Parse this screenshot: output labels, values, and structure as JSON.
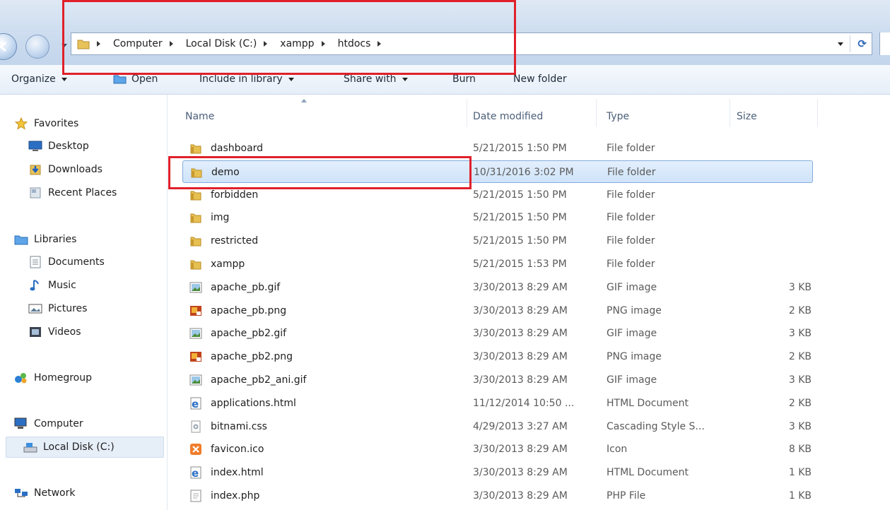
{
  "breadcrumb": [
    "Computer",
    "Local Disk (C:)",
    "xampp",
    "htdocs"
  ],
  "toolbar": {
    "organize": "Organize",
    "open": "Open",
    "include_in_library": "Include in library",
    "share_with": "Share with",
    "burn": "Burn",
    "new_folder": "New folder"
  },
  "nav": {
    "favorites": "Favorites",
    "desktop": "Desktop",
    "downloads": "Downloads",
    "recent_places": "Recent Places",
    "libraries": "Libraries",
    "documents": "Documents",
    "music": "Music",
    "pictures": "Pictures",
    "videos": "Videos",
    "homegroup": "Homegroup",
    "computer": "Computer",
    "local_disk": "Local Disk (C:)",
    "network": "Network"
  },
  "columns": {
    "name": "Name",
    "date": "Date modified",
    "type": "Type",
    "size": "Size"
  },
  "files": [
    {
      "name": "dashboard",
      "date": "5/21/2015 1:50 PM",
      "type": "File folder",
      "size": "",
      "icon": "folder-icon"
    },
    {
      "name": "demo",
      "date": "10/31/2016 3:02 PM",
      "type": "File folder",
      "size": "",
      "icon": "folder-icon",
      "selected": true
    },
    {
      "name": "forbidden",
      "date": "5/21/2015 1:50 PM",
      "type": "File folder",
      "size": "",
      "icon": "folder-icon"
    },
    {
      "name": "img",
      "date": "5/21/2015 1:50 PM",
      "type": "File folder",
      "size": "",
      "icon": "folder-icon"
    },
    {
      "name": "restricted",
      "date": "5/21/2015 1:50 PM",
      "type": "File folder",
      "size": "",
      "icon": "folder-icon"
    },
    {
      "name": "xampp",
      "date": "5/21/2015 1:53 PM",
      "type": "File folder",
      "size": "",
      "icon": "folder-icon"
    },
    {
      "name": "apache_pb.gif",
      "date": "3/30/2013 8:29 AM",
      "type": "GIF image",
      "size": "3 KB",
      "icon": "gif-image-icon"
    },
    {
      "name": "apache_pb.png",
      "date": "3/30/2013 8:29 AM",
      "type": "PNG image",
      "size": "2 KB",
      "icon": "png-image-icon"
    },
    {
      "name": "apache_pb2.gif",
      "date": "3/30/2013 8:29 AM",
      "type": "GIF image",
      "size": "3 KB",
      "icon": "gif-image-icon"
    },
    {
      "name": "apache_pb2.png",
      "date": "3/30/2013 8:29 AM",
      "type": "PNG image",
      "size": "2 KB",
      "icon": "png-image-icon"
    },
    {
      "name": "apache_pb2_ani.gif",
      "date": "3/30/2013 8:29 AM",
      "type": "GIF image",
      "size": "3 KB",
      "icon": "gif-image-icon"
    },
    {
      "name": "applications.html",
      "date": "11/12/2014 10:50 ...",
      "type": "HTML Document",
      "size": "2 KB",
      "icon": "html-document-icon"
    },
    {
      "name": "bitnami.css",
      "date": "4/29/2013 3:27 AM",
      "type": "Cascading Style S...",
      "size": "3 KB",
      "icon": "css-file-icon"
    },
    {
      "name": "favicon.ico",
      "date": "3/30/2013 8:29 AM",
      "type": "Icon",
      "size": "8 KB",
      "icon": "xampp-icon"
    },
    {
      "name": "index.html",
      "date": "3/30/2013 8:29 AM",
      "type": "HTML Document",
      "size": "1 KB",
      "icon": "html-document-icon"
    },
    {
      "name": "index.php",
      "date": "3/30/2013 8:29 AM",
      "type": "PHP File",
      "size": "1 KB",
      "icon": "php-file-icon"
    }
  ],
  "colors": {
    "highlight_box": "#e0202a",
    "selection": "#cfe3fa"
  }
}
